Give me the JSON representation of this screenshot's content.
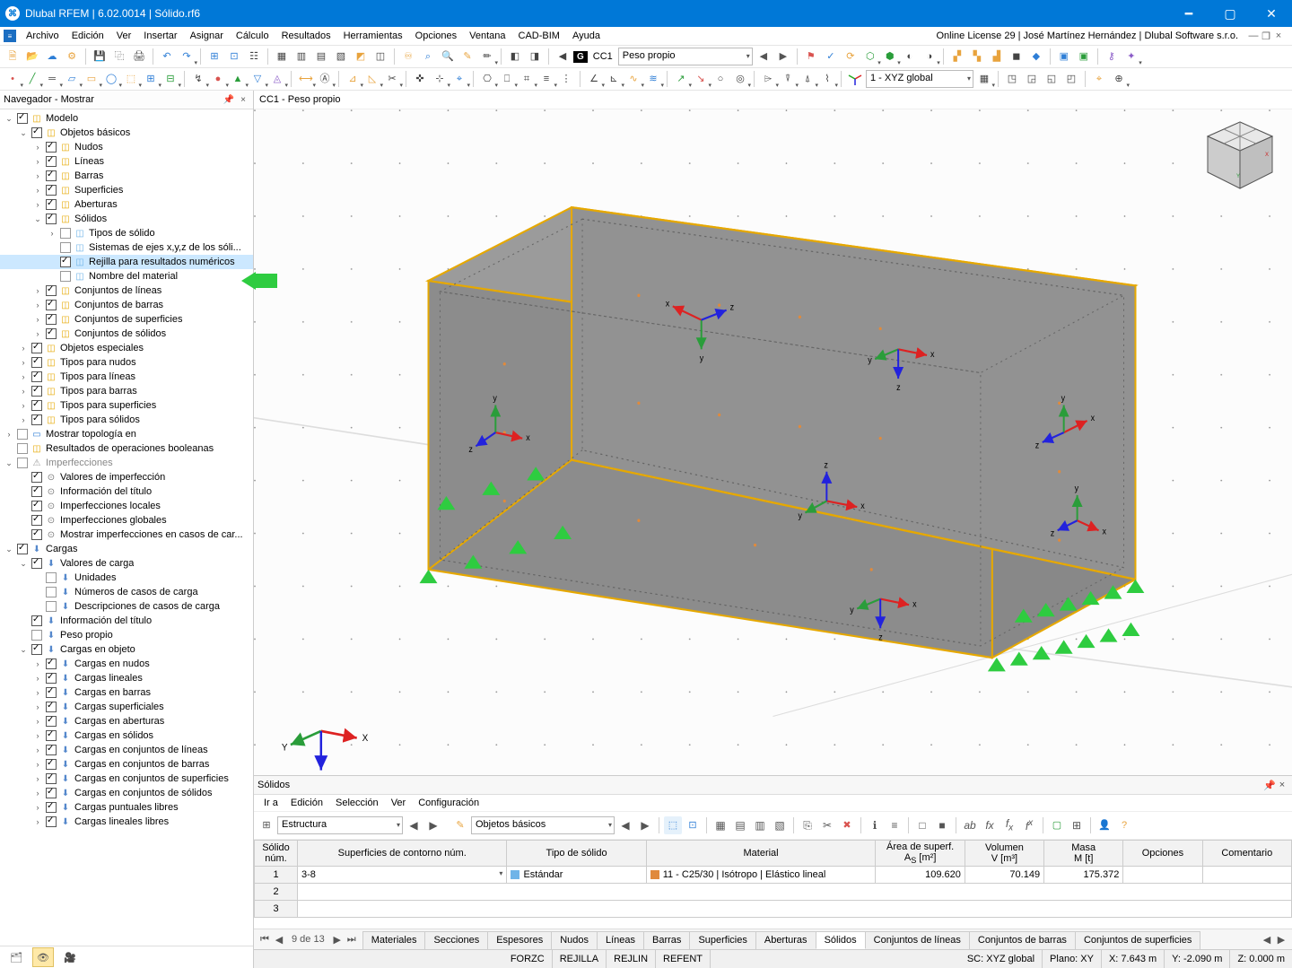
{
  "titlebar": {
    "title": "Dlubal RFEM | 6.02.0014 | Sólido.rf6"
  },
  "menubar": {
    "items": [
      "Archivo",
      "Edición",
      "Ver",
      "Insertar",
      "Asignar",
      "Cálculo",
      "Resultados",
      "Herramientas",
      "Opciones",
      "Ventana",
      "CAD-BIM",
      "Ayuda"
    ],
    "license": "Online License 29 | José Martínez Hernández | Dlubal Software s.r.o.",
    "ctrl_restore": "❐",
    "ctrl_close": "×"
  },
  "toolbar1": {
    "cc_badge": "G",
    "cc_label": "CC1",
    "load_combo": "Peso propio"
  },
  "toolbar2": {
    "coord_combo": "1 - XYZ global"
  },
  "navigator": {
    "title": "Navegador - Mostrar",
    "pin": "📌",
    "close": "×",
    "tree": [
      {
        "d": 0,
        "e": "o",
        "c": true,
        "i": "m",
        "t": "Modelo"
      },
      {
        "d": 1,
        "e": "o",
        "c": true,
        "i": "m",
        "t": "Objetos básicos"
      },
      {
        "d": 2,
        "e": "c",
        "c": true,
        "i": "m",
        "t": "Nudos"
      },
      {
        "d": 2,
        "e": "c",
        "c": true,
        "i": "m",
        "t": "Líneas"
      },
      {
        "d": 2,
        "e": "c",
        "c": true,
        "i": "m",
        "t": "Barras"
      },
      {
        "d": 2,
        "e": "c",
        "c": true,
        "i": "m",
        "t": "Superficies"
      },
      {
        "d": 2,
        "e": "c",
        "c": true,
        "i": "m",
        "t": "Aberturas"
      },
      {
        "d": 2,
        "e": "o",
        "c": true,
        "i": "m",
        "t": "Sólidos"
      },
      {
        "d": 3,
        "e": "c",
        "c": false,
        "i": "s",
        "t": "Tipos de sólido"
      },
      {
        "d": 3,
        "e": "n",
        "c": false,
        "i": "s",
        "t": "Sistemas de ejes x,y,z de los sóli..."
      },
      {
        "d": 3,
        "e": "n",
        "c": true,
        "i": "s",
        "t": "Rejilla para resultados numéricos",
        "sel": true
      },
      {
        "d": 3,
        "e": "n",
        "c": false,
        "i": "s",
        "t": "Nombre del material"
      },
      {
        "d": 2,
        "e": "c",
        "c": true,
        "i": "m",
        "t": "Conjuntos de líneas"
      },
      {
        "d": 2,
        "e": "c",
        "c": true,
        "i": "m",
        "t": "Conjuntos de barras"
      },
      {
        "d": 2,
        "e": "c",
        "c": true,
        "i": "m",
        "t": "Conjuntos de superficies"
      },
      {
        "d": 2,
        "e": "c",
        "c": true,
        "i": "m",
        "t": "Conjuntos de sólidos"
      },
      {
        "d": 1,
        "e": "c",
        "c": true,
        "i": "m",
        "t": "Objetos especiales"
      },
      {
        "d": 1,
        "e": "c",
        "c": true,
        "i": "m",
        "t": "Tipos para nudos"
      },
      {
        "d": 1,
        "e": "c",
        "c": true,
        "i": "m",
        "t": "Tipos para líneas"
      },
      {
        "d": 1,
        "e": "c",
        "c": true,
        "i": "m",
        "t": "Tipos para barras"
      },
      {
        "d": 1,
        "e": "c",
        "c": true,
        "i": "m",
        "t": "Tipos para superficies"
      },
      {
        "d": 1,
        "e": "c",
        "c": true,
        "i": "m",
        "t": "Tipos para sólidos"
      },
      {
        "d": 0,
        "e": "c",
        "c": false,
        "i": "b",
        "t": "Mostrar topología en"
      },
      {
        "d": 0,
        "e": "n",
        "c": false,
        "i": "m",
        "t": "Resultados de operaciones booleanas"
      },
      {
        "d": 0,
        "e": "o",
        "c": false,
        "i": "d",
        "t": "Imperfecciones",
        "dim": true
      },
      {
        "d": 1,
        "e": "n",
        "c": true,
        "i": "g",
        "t": "Valores de imperfección"
      },
      {
        "d": 1,
        "e": "n",
        "c": true,
        "i": "g",
        "t": "Información del título"
      },
      {
        "d": 1,
        "e": "n",
        "c": true,
        "i": "g",
        "t": "Imperfecciones locales"
      },
      {
        "d": 1,
        "e": "n",
        "c": true,
        "i": "g",
        "t": "Imperfecciones globales"
      },
      {
        "d": 1,
        "e": "n",
        "c": true,
        "i": "g",
        "t": "Mostrar imperfecciones en casos de car..."
      },
      {
        "d": 0,
        "e": "o",
        "c": true,
        "i": "l",
        "t": "Cargas"
      },
      {
        "d": 1,
        "e": "o",
        "c": true,
        "i": "l",
        "t": "Valores de carga"
      },
      {
        "d": 2,
        "e": "n",
        "c": false,
        "i": "l",
        "t": "Unidades"
      },
      {
        "d": 2,
        "e": "n",
        "c": false,
        "i": "l",
        "t": "Números de casos de carga"
      },
      {
        "d": 2,
        "e": "n",
        "c": false,
        "i": "l",
        "t": "Descripciones de casos de carga"
      },
      {
        "d": 1,
        "e": "n",
        "c": true,
        "i": "l",
        "t": "Información del título"
      },
      {
        "d": 1,
        "e": "n",
        "c": false,
        "i": "l",
        "t": "Peso propio"
      },
      {
        "d": 1,
        "e": "o",
        "c": true,
        "i": "l",
        "t": "Cargas en objeto"
      },
      {
        "d": 2,
        "e": "c",
        "c": true,
        "i": "l",
        "t": "Cargas en nudos"
      },
      {
        "d": 2,
        "e": "c",
        "c": true,
        "i": "l",
        "t": "Cargas lineales"
      },
      {
        "d": 2,
        "e": "c",
        "c": true,
        "i": "l",
        "t": "Cargas en barras"
      },
      {
        "d": 2,
        "e": "c",
        "c": true,
        "i": "l",
        "t": "Cargas superficiales"
      },
      {
        "d": 2,
        "e": "c",
        "c": true,
        "i": "l",
        "t": "Cargas en aberturas"
      },
      {
        "d": 2,
        "e": "c",
        "c": true,
        "i": "l",
        "t": "Cargas en sólidos"
      },
      {
        "d": 2,
        "e": "c",
        "c": true,
        "i": "l",
        "t": "Cargas en conjuntos de líneas"
      },
      {
        "d": 2,
        "e": "c",
        "c": true,
        "i": "l",
        "t": "Cargas en conjuntos de barras"
      },
      {
        "d": 2,
        "e": "c",
        "c": true,
        "i": "l",
        "t": "Cargas en conjuntos de superficies"
      },
      {
        "d": 2,
        "e": "c",
        "c": true,
        "i": "l",
        "t": "Cargas en conjuntos de sólidos"
      },
      {
        "d": 2,
        "e": "c",
        "c": true,
        "i": "l",
        "t": "Cargas puntuales libres"
      },
      {
        "d": 2,
        "e": "c",
        "c": true,
        "i": "l",
        "t": "Cargas lineales libres"
      }
    ]
  },
  "canvas": {
    "header": "CC1 - Peso propio"
  },
  "solids": {
    "title": "Sólidos",
    "pin": "📌",
    "close": "×",
    "menu": [
      "Ir a",
      "Edición",
      "Selección",
      "Ver",
      "Configuración"
    ],
    "combo1": "Estructura",
    "combo2": "Objetos básicos",
    "headers": {
      "h1": "Sólido\nnúm.",
      "h2": "Superficies de contorno núm.",
      "h3": "Tipo de sólido",
      "h4": "Material",
      "h5": "Área de superf.\nA<sub>S</sub> [m²]",
      "h6": "Volumen\nV [m³]",
      "h7": "Masa\nM [t]",
      "h8": "Opciones",
      "h9": "Comentario"
    },
    "rows": [
      {
        "n": "1",
        "surf": "3-8",
        "tipo": "Estándar",
        "mat": "11 - C25/30 | Isótropo | Elástico lineal",
        "area": "109.620",
        "vol": "70.149",
        "masa": "175.372",
        "opc": "",
        "com": ""
      },
      {
        "n": "2"
      },
      {
        "n": "3"
      }
    ]
  },
  "bottom_tabs": {
    "page": "9 de 13",
    "tabs": [
      "Materiales",
      "Secciones",
      "Espesores",
      "Nudos",
      "Líneas",
      "Barras",
      "Superficies",
      "Aberturas",
      "Sólidos",
      "Conjuntos de líneas",
      "Conjuntos de barras",
      "Conjuntos de superficies"
    ],
    "active": 8
  },
  "statusbar": {
    "s1": "FORZC",
    "s2": "REJILLA",
    "s3": "REJLIN",
    "s4": "REFENT",
    "coord": "SC: XYZ global",
    "plano": "Plano: XY",
    "x": "X: 7.643 m",
    "y": "Y: -2.090 m",
    "z": "Z: 0.000 m"
  }
}
